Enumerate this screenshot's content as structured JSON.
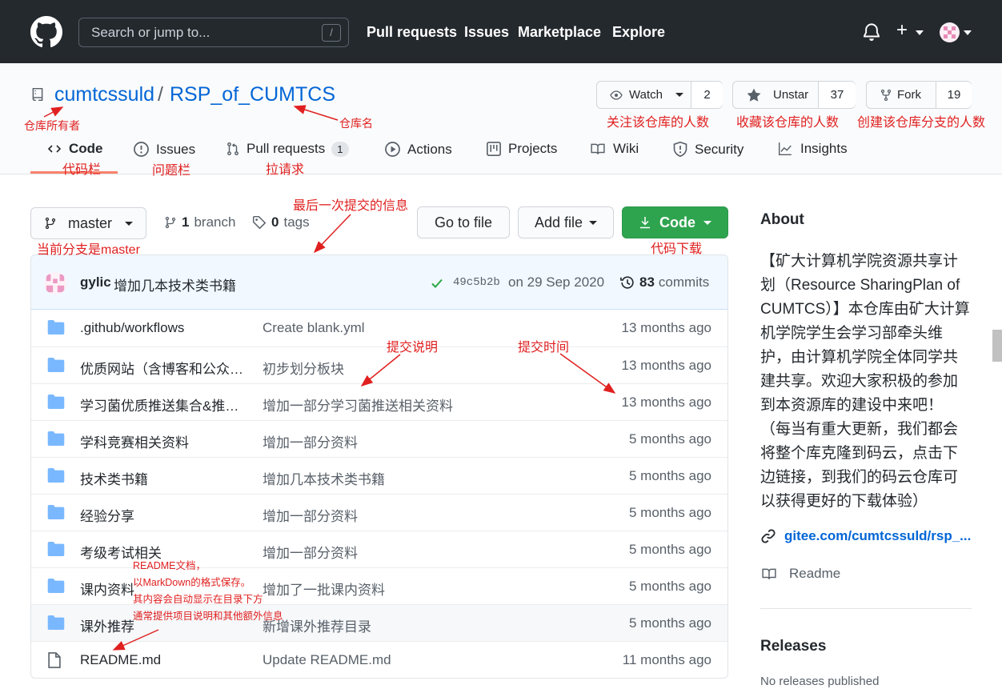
{
  "topnav": {
    "search_placeholder": "Search or jump to...",
    "search_shortcut": "/",
    "links": [
      "Pull requests",
      "Issues",
      "Marketplace",
      "Explore"
    ]
  },
  "repo": {
    "owner": "cumtcssuld",
    "separator": "/",
    "name": "RSP_of_CUMTCS",
    "watch": {
      "label": "Watch",
      "count": "2"
    },
    "star": {
      "label": "Unstar",
      "count": "37"
    },
    "fork": {
      "label": "Fork",
      "count": "19"
    },
    "tabs": {
      "code": "Code",
      "issues": "Issues",
      "pulls": "Pull requests",
      "pulls_count": "1",
      "actions": "Actions",
      "projects": "Projects",
      "wiki": "Wiki",
      "security": "Security",
      "insights": "Insights"
    }
  },
  "toolbar": {
    "branch": "master",
    "branch_count": "1",
    "branch_label": "branch",
    "tag_count": "0",
    "tag_label": "tags",
    "go_to_file": "Go to file",
    "add_file": "Add file",
    "code": "Code"
  },
  "commit": {
    "author": "gylic",
    "message": "增加几本技术类书籍",
    "sha": "49c5b2b",
    "date": "on 29 Sep 2020",
    "count": "83",
    "count_label": "commits"
  },
  "files": [
    {
      "type": "dir",
      "name": ".github/workflows",
      "msg": "Create blank.yml",
      "age": "13 months ago"
    },
    {
      "type": "dir",
      "name": "优质网站（含博客和公众号）",
      "msg": "初步划分板块",
      "age": "13 months ago"
    },
    {
      "type": "dir",
      "name": "学习菌优质推送集合&推送资料",
      "msg": "增加一部分学习菌推送相关资料",
      "age": "13 months ago"
    },
    {
      "type": "dir",
      "name": "学科竞赛相关资料",
      "msg": "增加一部分资料",
      "age": "5 months ago"
    },
    {
      "type": "dir",
      "name": "技术类书籍",
      "msg": "增加几本技术类书籍",
      "age": "5 months ago"
    },
    {
      "type": "dir",
      "name": "经验分享",
      "msg": "增加一部分资料",
      "age": "5 months ago"
    },
    {
      "type": "dir",
      "name": "考级考试相关",
      "msg": "增加一部分资料",
      "age": "5 months ago"
    },
    {
      "type": "dir",
      "name": "课内资料",
      "msg": "增加了一批课内资料",
      "age": "5 months ago"
    },
    {
      "type": "dir",
      "name": "课外推荐",
      "msg": "新增课外推荐目录",
      "age": "5 months ago"
    },
    {
      "type": "file",
      "name": "README.md",
      "msg": "Update README.md",
      "age": "11 months ago"
    }
  ],
  "sidebar": {
    "about_title": "About",
    "about_text": "【矿大计算机学院资源共享计划（Resource SharingPlan of CUMTCS）】本仓库由矿大计算机学院学生会学习部牵头维护，由计算机学院全体同学共建共享。欢迎大家积极的参加到本资源库的建设中来吧！（每当有重大更新，我们都会将整个库克隆到码云，点击下边链接，到我们的码云仓库可以获得更好的下载体验）",
    "link": "gitee.com/cumtcssuld/rsp_...",
    "readme": "Readme",
    "releases_title": "Releases",
    "releases_text": "No releases published"
  },
  "annotations": {
    "owner": "仓库所有者",
    "repo_name": "仓库名",
    "watch": "关注该仓库的人数",
    "star": "收藏该仓库的人数",
    "fork": "创建该仓库分支的人数",
    "code_tab": "代码栏",
    "issues_tab": "问题栏",
    "pulls_tab": "拉请求",
    "last_commit": "最后一次提交的信息",
    "branch": "当前分支是master",
    "download": "代码下载",
    "commit_msg": "提交说明",
    "commit_time": "提交时间",
    "readme_1": "README文档，",
    "readme_2": "以MarkDown的格式保存。",
    "readme_3": "其内容会自动显示在目录下方",
    "readme_4": "通常提供项目说明和其他额外信息"
  },
  "colors": {
    "accent": "#0366d6",
    "green": "#2ea44f",
    "annotation": "#e02020",
    "nav_bg": "#24292e",
    "folder": "#79b8ff"
  }
}
